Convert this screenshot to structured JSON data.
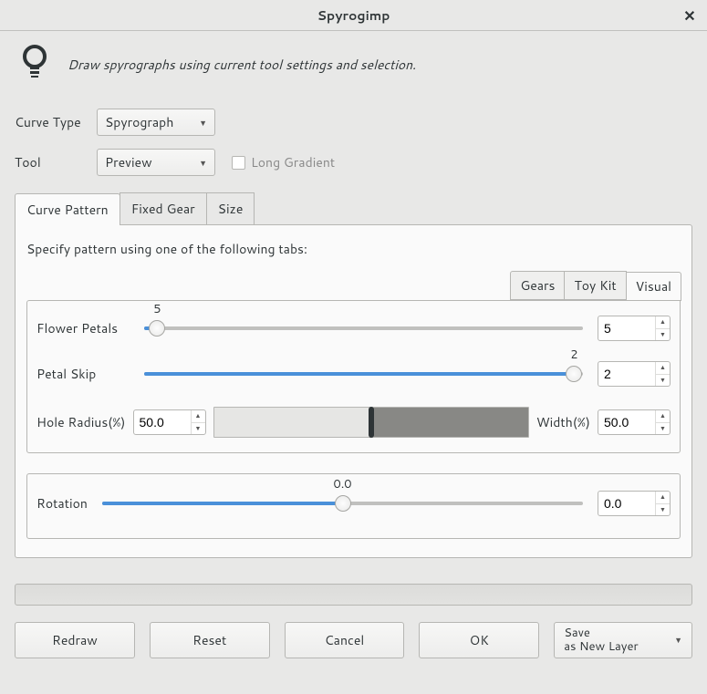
{
  "window": {
    "title": "Spyrogimp",
    "close_icon": "✕"
  },
  "hint": {
    "text": "Draw spyrographs using current tool settings and selection."
  },
  "form": {
    "curve_type_label": "Curve Type",
    "curve_type_value": "Spyrograph",
    "tool_label": "Tool",
    "tool_value": "Preview",
    "long_gradient_label": "Long Gradient"
  },
  "tabs": {
    "curve_pattern": "Curve Pattern",
    "fixed_gear": "Fixed Gear",
    "size": "Size"
  },
  "pattern": {
    "instruction": "Specify pattern using one of the following tabs:",
    "inner_tabs": {
      "gears": "Gears",
      "toy_kit": "Toy Kit",
      "visual": "Visual"
    },
    "flower_petals_label": "Flower Petals",
    "flower_petals_value": "5",
    "flower_petals_mark": "5",
    "petal_skip_label": "Petal Skip",
    "petal_skip_value": "2",
    "petal_skip_mark": "2",
    "hole_radius_label": "Hole Radius(%)",
    "hole_radius_value": "50.0",
    "width_label": "Width(%)",
    "width_value": "50.0"
  },
  "rotation": {
    "label": "Rotation",
    "mark": "0.0",
    "value": "0.0"
  },
  "buttons": {
    "redraw": "Redraw",
    "reset": "Reset",
    "cancel": "Cancel",
    "ok": "OK",
    "save_line1": "Save",
    "save_line2": "as New Layer"
  }
}
